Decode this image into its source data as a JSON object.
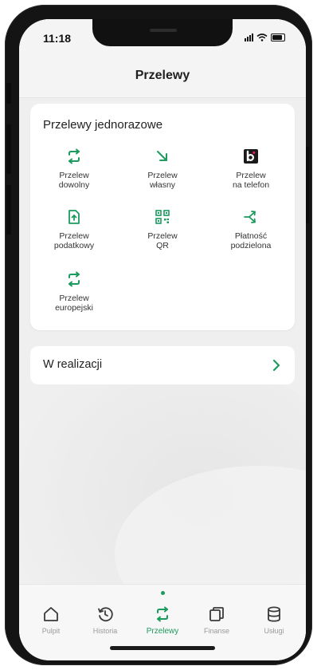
{
  "status_bar": {
    "time": "11:18"
  },
  "header": {
    "title": "Przelewy"
  },
  "one_time_transfers": {
    "title": "Przelewy jednorazowe",
    "items": [
      {
        "label_line1": "Przelew",
        "label_line2": "dowolny",
        "icon": "arrows-exchange-icon"
      },
      {
        "label_line1": "Przelew",
        "label_line2": "własny",
        "icon": "arrow-down-right-icon"
      },
      {
        "label_line1": "Przelew",
        "label_line2": "na telefon",
        "icon": "blik-icon"
      },
      {
        "label_line1": "Przelew",
        "label_line2": "podatkowy",
        "icon": "document-upload-icon"
      },
      {
        "label_line1": "Przelew",
        "label_line2": "QR",
        "icon": "qr-code-icon"
      },
      {
        "label_line1": "Płatność",
        "label_line2": "podzielona",
        "icon": "split-arrows-icon"
      },
      {
        "label_line1": "Przelew",
        "label_line2": "europejski",
        "icon": "arrows-exchange-icon"
      }
    ]
  },
  "in_progress": {
    "label": "W realizacji",
    "icon": "chevron-right-icon"
  },
  "bottom_nav": {
    "items": [
      {
        "label": "Pulpit",
        "icon": "home-icon"
      },
      {
        "label": "Historia",
        "icon": "history-icon"
      },
      {
        "label": "Przelewy",
        "icon": "transfer-icon",
        "active": true
      },
      {
        "label": "Finanse",
        "icon": "wallet-icon"
      },
      {
        "label": "Usługi",
        "icon": "database-icon"
      }
    ]
  },
  "colors": {
    "accent": "#1d9b5e",
    "background": "#efefef",
    "card": "#ffffff"
  }
}
